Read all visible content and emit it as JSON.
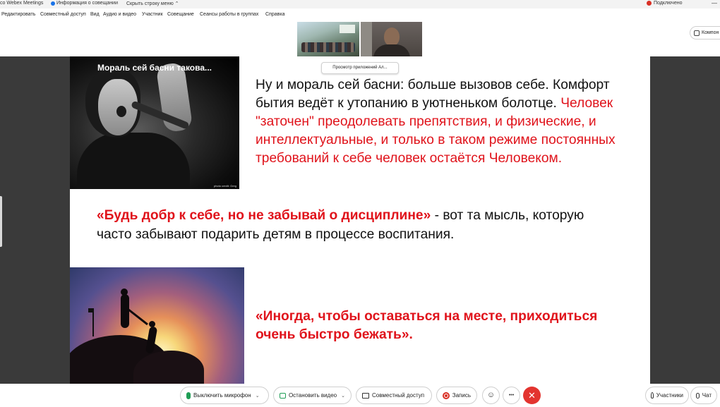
{
  "titlebar": {
    "app_title": "co Webex Meetings",
    "meeting_info": "Информация о совещании",
    "hide_menu": "Скрыть строку меню ⌃",
    "status": "Подключено",
    "minimize": "—"
  },
  "menu": {
    "items": [
      "Редактировать",
      "Совместный доступ",
      "Вид",
      "Аудио и видео",
      "Участник",
      "Совещание",
      "Сеансы работы в группах",
      "Справка"
    ]
  },
  "companion": {
    "label": "Компон"
  },
  "share": {
    "apps_viewer": "Просмотр приложений Ал..."
  },
  "slide": {
    "photo1_caption": "Мораль сей басни такова...",
    "photo1_credit": "photo credit: Greg",
    "para1_black": "Ну и мораль сей басни: больше вызовов себе. Комфорт бытия ведёт к утопанию в уютненьком болотце. ",
    "para1_red": "Человек \"заточен\" преодолевать препятствия, и физические, и интеллектуальные, и только в таком режиме постоянных требований к себе человек остаётся Человеком.",
    "quote1_red": "«Будь добр к себе, но не забывай о дисциплине»",
    "quote1_black": " - вот та мысль, которую часто забывают подарить детям в процессе воспитания.",
    "quote2": "«Иногда, чтобы оставаться на месте, приходиться очень быстро бежать»."
  },
  "toolbar": {
    "mute_label": "Выключить микрофон",
    "video_label": "Остановить видео",
    "share_label": "Совместный доступ",
    "record_label": "Запись",
    "emoji_icon": "☺",
    "more_icon": "•••",
    "end_icon": "✕",
    "participants_label": "Участники",
    "chat_label": "Чат",
    "chevron": "⌄"
  },
  "colors": {
    "accent_red": "#e0131b",
    "mic_green": "#1f9d55",
    "end_red": "#e3342f"
  }
}
